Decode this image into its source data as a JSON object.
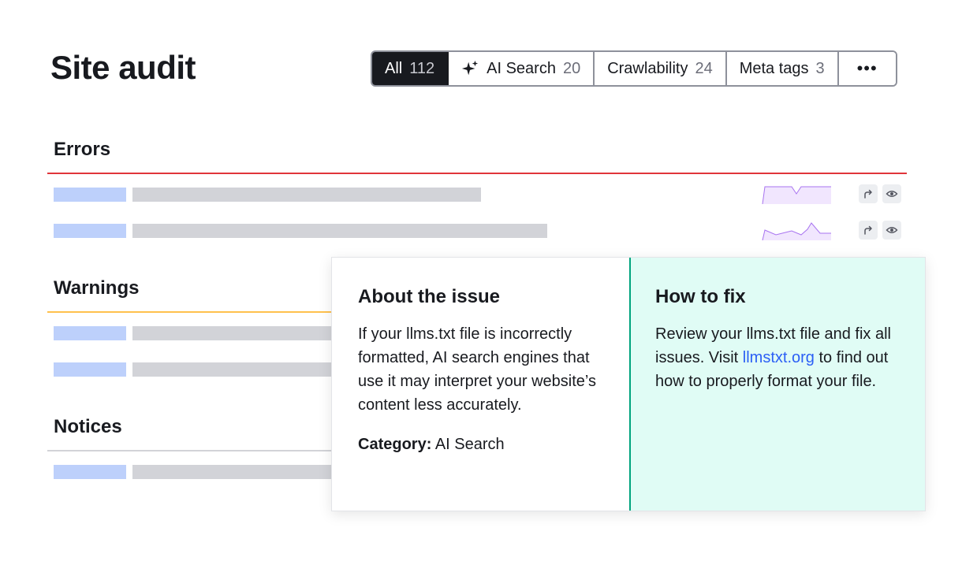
{
  "page_title": "Site audit",
  "tabs": [
    {
      "label": "All",
      "count": "112",
      "active": true
    },
    {
      "label": "AI Search",
      "count": "20",
      "icon": "sparkle-icon"
    },
    {
      "label": "Crawlability",
      "count": "24"
    },
    {
      "label": "Meta tags",
      "count": "3"
    },
    {
      "label": "•••",
      "icon": "more-icon"
    }
  ],
  "sections": {
    "errors": {
      "title": "Errors",
      "color": "#e0353a"
    },
    "warnings": {
      "title": "Warnings",
      "color": "#ffc14d"
    },
    "notices": {
      "title": "Notices",
      "color": "#d2d3d8"
    }
  },
  "row_actions": {
    "share_icon": "share-arrow-icon",
    "view_icon": "eye-icon"
  },
  "popup": {
    "about": {
      "heading": "About the issue",
      "body": "If your llms.txt file is incorrectly formatted, AI search engines that use it may interpret your website’s content less accurately.",
      "category_label": "Category:",
      "category_value": "AI Search"
    },
    "fix": {
      "heading": "How to fix",
      "body_before": "Review your llms.txt file and fix all issues. Visit ",
      "link_text": "llmstxt.org",
      "body_after": " to find out how to properly format your file."
    }
  },
  "colors": {
    "accent_dark": "#181a1f",
    "placeholder_blue": "#bdd0fb",
    "placeholder_gray": "#d2d3d8",
    "trend_purple": "#a874f0",
    "fix_bg": "#e0fcf5",
    "fix_border": "#00a47d",
    "link": "#2b5ff5"
  }
}
